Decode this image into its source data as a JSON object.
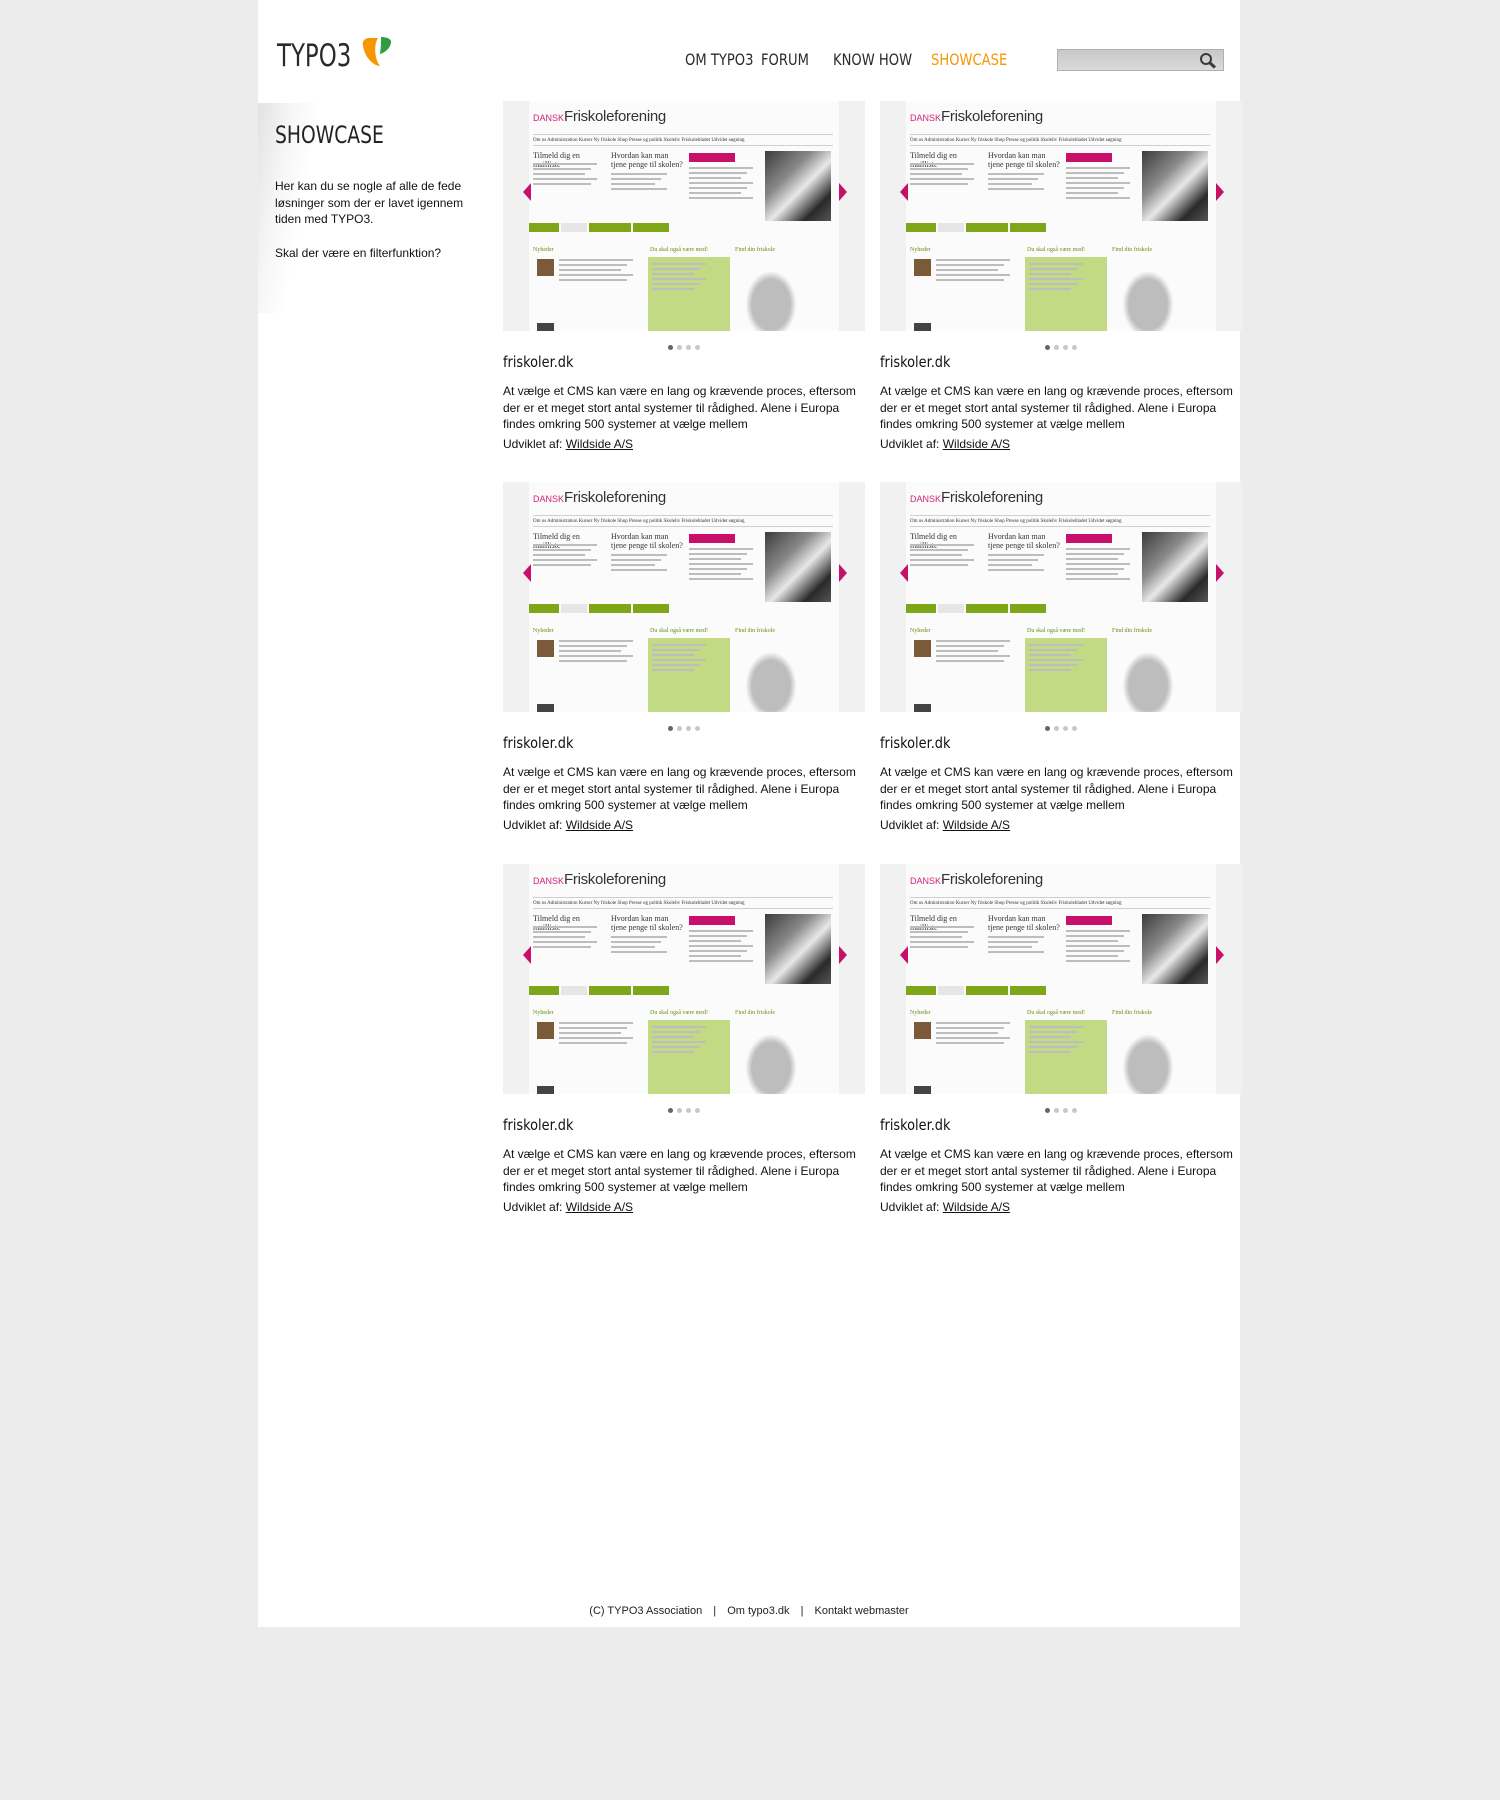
{
  "header": {
    "logo_text": "TYPO3",
    "nav": [
      {
        "label": "OM TYPO3",
        "active": false
      },
      {
        "label": "FORUM",
        "active": false
      },
      {
        "label": "KNOW HOW",
        "active": false
      },
      {
        "label": "SHOWCASE",
        "active": true
      }
    ],
    "search": {
      "placeholder": "",
      "value": ""
    }
  },
  "sidebar": {
    "title": "SHOWCASE",
    "intro": "Her kan du se nogle af alle de fede løsninger som der er lavet igennem tiden med TYPO3.",
    "question": "Skal der være en filterfunktion?"
  },
  "showcase": {
    "items": [
      {
        "title": "friskoler.dk",
        "description": "At vælge et CMS kan være en lang og krævende proces, eftersom der er et meget stort antal systemer til rådighed. Alene i Europa findes omkring 500 systemer at vælge mellem",
        "developer_label": "Udviklet af:",
        "developer": "Wildside A/S",
        "slide": 1,
        "slides": 4
      },
      {
        "title": "friskoler.dk",
        "description": "At vælge et CMS kan være en lang og krævende proces, eftersom der er et meget stort antal systemer til rådighed. Alene i Europa findes omkring 500 systemer at vælge mellem",
        "developer_label": "Udviklet af:",
        "developer": "Wildside A/S",
        "slide": 1,
        "slides": 4
      },
      {
        "title": "friskoler.dk",
        "description": "At vælge et CMS kan være en lang og krævende proces, eftersom der er et meget stort antal systemer til rådighed. Alene i Europa findes omkring 500 systemer at vælge mellem",
        "developer_label": "Udviklet af:",
        "developer": "Wildside A/S",
        "slide": 1,
        "slides": 4
      },
      {
        "title": "friskoler.dk",
        "description": "At vælge et CMS kan være en lang og krævende proces, eftersom der er et meget stort antal systemer til rådighed. Alene i Europa findes omkring 500 systemer at vælge mellem",
        "developer_label": "Udviklet af:",
        "developer": "Wildside A/S",
        "slide": 1,
        "slides": 4
      },
      {
        "title": "friskoler.dk",
        "description": "At vælge et CMS kan være en lang og krævende proces, eftersom der er et meget stort antal systemer til rådighed. Alene i Europa findes omkring 500 systemer at vælge mellem",
        "developer_label": "Udviklet af:",
        "developer": "Wildside A/S",
        "slide": 1,
        "slides": 4
      },
      {
        "title": "friskoler.dk",
        "description": "At vælge et CMS kan være en lang og krævende proces, eftersom der er et meget stort antal systemer til rådighed. Alene i Europa findes omkring 500 systemer at vælge mellem",
        "developer_label": "Udviklet af:",
        "developer": "Wildside A/S",
        "slide": 1,
        "slides": 4
      }
    ],
    "screenshot": {
      "brand_prefix": "DANSK",
      "brand_name": "Friskoleforening",
      "menu": "Om os   Administration   Kurser   Ny friskole   Shop   Presse og politik   Skoleliv   Friskolebladet   Udvidet søgning",
      "heading_1": "Tilmeld dig en mailliste",
      "heading_2": "Hvordan kan man tjene penge til skolen?",
      "news_heading": "Nyheder",
      "mid_heading": "Du skal også være med!",
      "right_heading": "Find din friskole"
    }
  },
  "footer": {
    "items": [
      "(C) TYPO3 Association",
      "Om typo3.dk",
      "Kontakt webmaster"
    ],
    "separator": "|"
  },
  "colors": {
    "accent": "#f49700",
    "background": "#ececec",
    "slider_arrow": "#c8106b",
    "tab_green": "#7fa619"
  }
}
